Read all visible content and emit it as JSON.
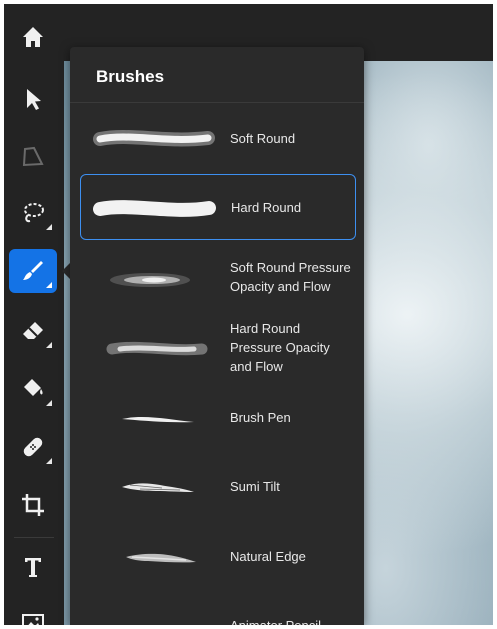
{
  "panel": {
    "title": "Brushes",
    "brushes": [
      {
        "label": "Soft Round",
        "selected": false
      },
      {
        "label": "Hard Round",
        "selected": true
      },
      {
        "label": "Soft Round Pressure Opacity and Flow",
        "selected": false
      },
      {
        "label": "Hard Round Pressure Opacity and Flow",
        "selected": false
      },
      {
        "label": "Brush Pen",
        "selected": false
      },
      {
        "label": "Sumi Tilt",
        "selected": false
      },
      {
        "label": "Natural Edge",
        "selected": false
      },
      {
        "label": "Animator Pencil",
        "selected": false
      }
    ]
  },
  "toolbar": {
    "tools": [
      {
        "name": "select-tool",
        "icon": "arrow-cursor-icon"
      },
      {
        "name": "lasso-polygon-tool",
        "icon": "polygon-lasso-icon"
      },
      {
        "name": "lasso-tool",
        "icon": "lasso-icon"
      },
      {
        "name": "brush-tool",
        "icon": "paintbrush-icon",
        "active": true
      },
      {
        "name": "eraser-tool",
        "icon": "eraser-icon"
      },
      {
        "name": "fill-tool",
        "icon": "paint-bucket-icon"
      },
      {
        "name": "healing-tool",
        "icon": "bandage-icon"
      },
      {
        "name": "crop-tool",
        "icon": "crop-icon"
      },
      {
        "name": "type-tool",
        "icon": "type-icon",
        "glyph": "T"
      },
      {
        "name": "image-tool",
        "icon": "image-icon"
      }
    ]
  },
  "colors": {
    "accent": "#1473e6",
    "panel": "#2a2a2a",
    "toolbar": "#232323"
  }
}
